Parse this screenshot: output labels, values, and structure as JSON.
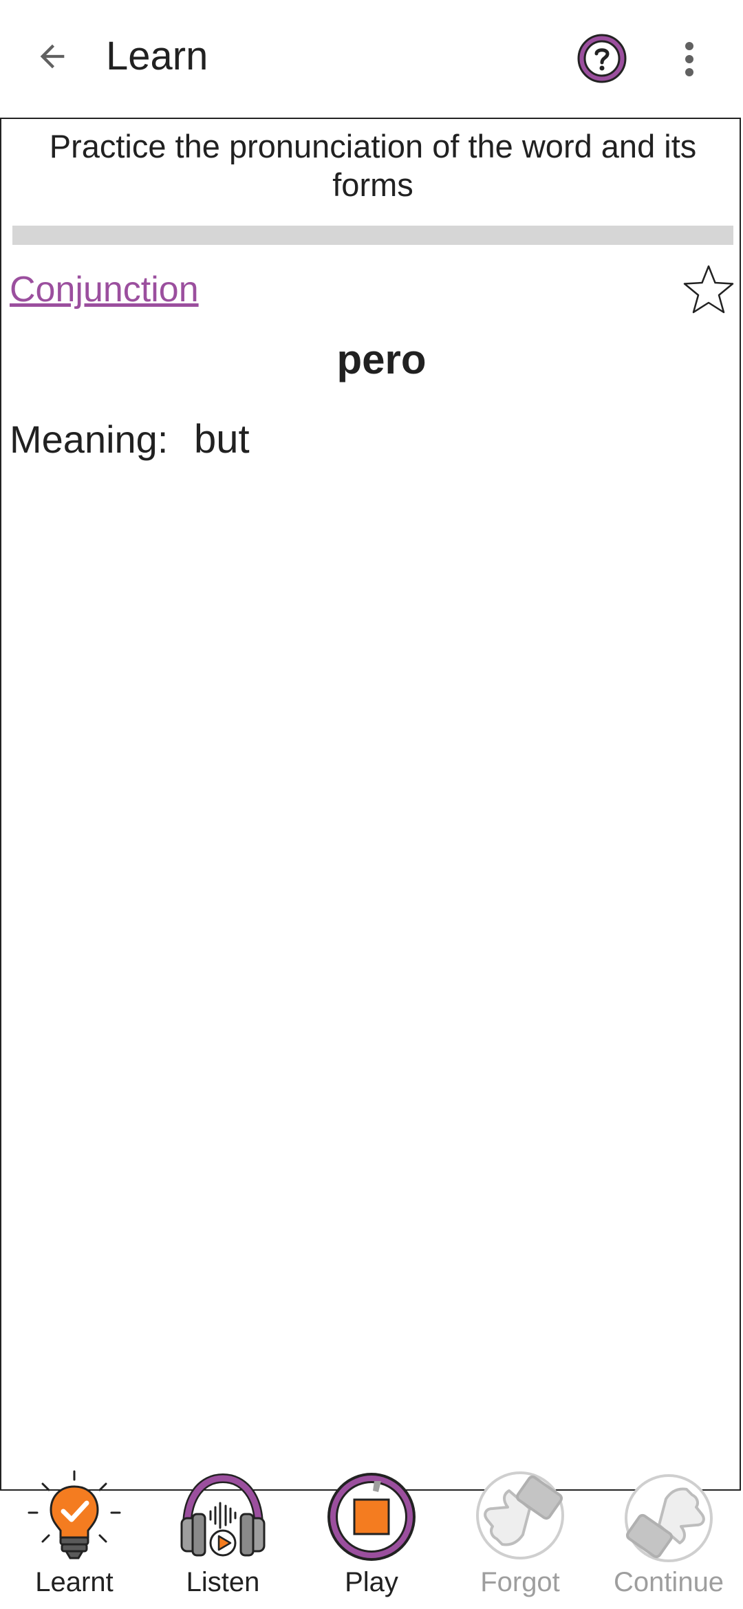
{
  "appbar": {
    "title": "Learn",
    "back_icon": "arrow-left-icon",
    "help_icon": "question-circle-icon",
    "more_icon": "more-vertical-icon"
  },
  "card": {
    "instruction": "Practice the pronunciation of the word and its forms",
    "progress": 0,
    "part_of_speech": "Conjunction",
    "favorite_icon": "star-outline-icon",
    "word": "pero",
    "meaning_label": "Meaning:",
    "meaning_value": "but"
  },
  "actions": [
    {
      "label": "Learnt",
      "icon": "lightbulb-check-icon",
      "enabled": true
    },
    {
      "label": "Listen",
      "icon": "headphones-play-icon",
      "enabled": true
    },
    {
      "label": "Play",
      "icon": "stop-record-icon",
      "enabled": true
    },
    {
      "label": "Forgot",
      "icon": "thumbs-down-icon",
      "enabled": false
    },
    {
      "label": "Continue",
      "icon": "thumbs-up-icon",
      "enabled": false
    }
  ],
  "colors": {
    "accent": "#9b4f9e",
    "orange": "#f47c20",
    "disabled": "#9e9e9e"
  }
}
